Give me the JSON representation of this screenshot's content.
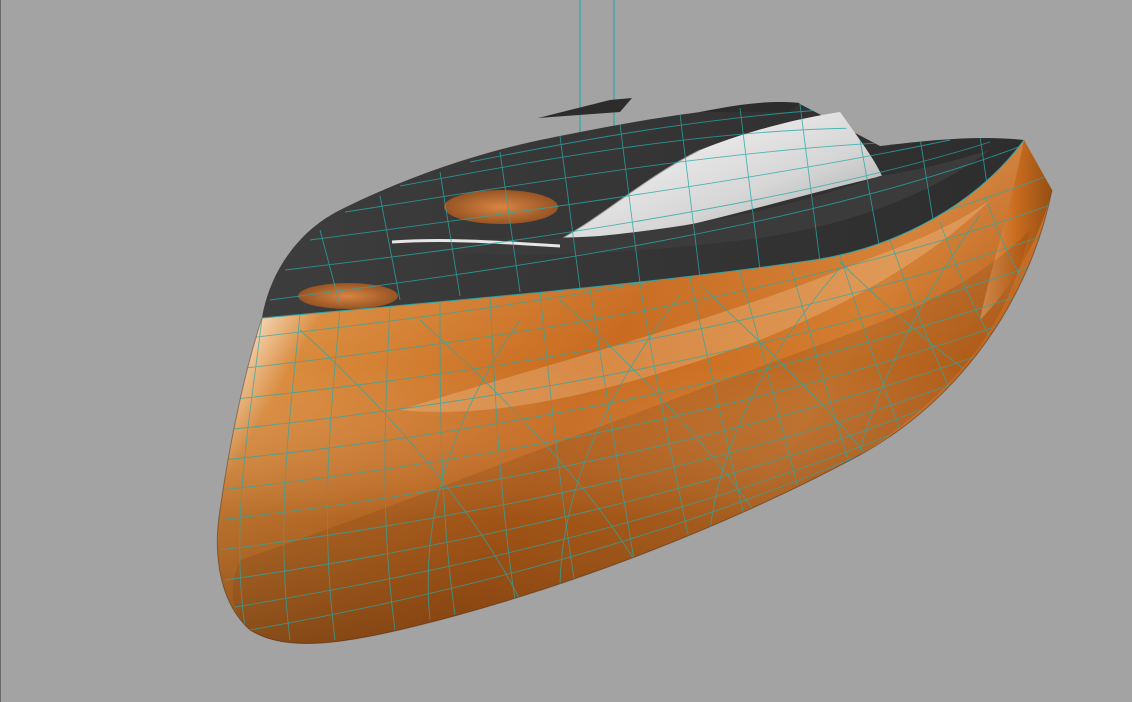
{
  "viewport": {
    "background_color": "#a3a3a3",
    "model": "yacht-hull",
    "shading": "rendered-with-wireframe-overlay"
  },
  "colors": {
    "hull": "#d9822b",
    "hull_shadow": "#9a4f12",
    "hull_highlight": "#f7d2a4",
    "deck": "#3a3a3a",
    "cabin_top": "#2f2f2f",
    "windshield": "#d8d8d8",
    "wireframe": "#2aa8a8",
    "hatch": "#c9733a"
  }
}
